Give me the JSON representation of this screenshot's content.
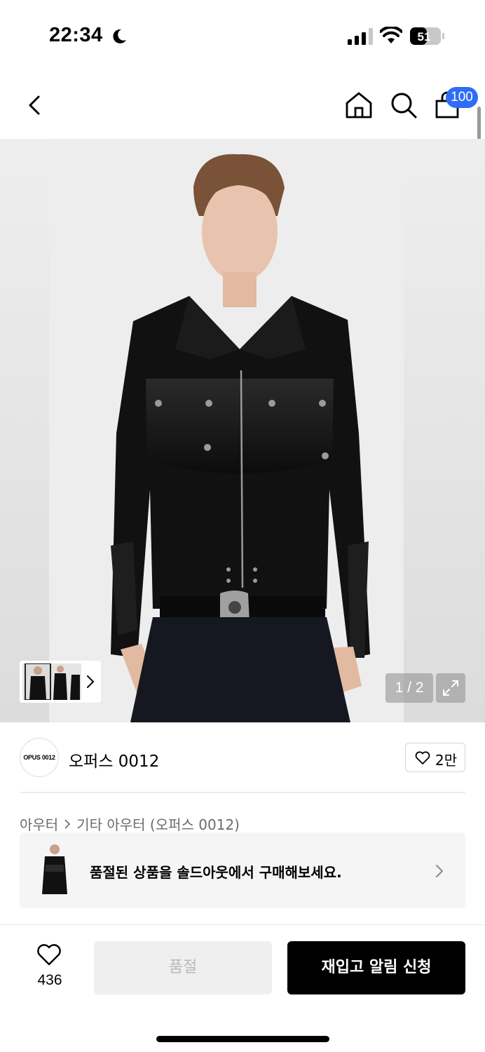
{
  "status_bar": {
    "time": "22:34",
    "battery": "51",
    "icons": [
      "moon-icon",
      "signal-icon",
      "wifi-icon",
      "battery-icon"
    ]
  },
  "nav": {
    "icons": [
      "back-icon",
      "home-icon",
      "search-icon",
      "cart-icon"
    ],
    "cart_badge": "100"
  },
  "gallery": {
    "counter": "1 / 2",
    "icons": [
      "expand-icon",
      "chevron-right-icon"
    ]
  },
  "brand": {
    "logo_text": "OPUS 0012",
    "name": "오퍼스 0012",
    "like_count": "2만"
  },
  "breadcrumb": {
    "items": [
      "아우터",
      "기타 아우터 (오퍼스 0012)"
    ]
  },
  "soldout_banner": {
    "text": "품절된 상품을 솔드아웃에서 구매해보세요."
  },
  "bottom_bar": {
    "wish_count": "436",
    "soldout_label": "품절",
    "restock_label": "재입고 알림 신청"
  },
  "colors": {
    "accent": "#2f6df6",
    "primary_button": "#000000",
    "disabled_button": "#efefef"
  }
}
